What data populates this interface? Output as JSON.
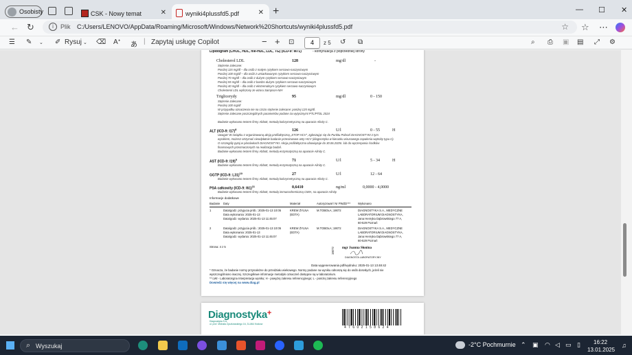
{
  "browser": {
    "profile": "Osobisty",
    "tabs": [
      {
        "title": "CSK - Nowy temat"
      },
      {
        "title": "wyniki4plussfd5.pdf"
      }
    ],
    "address_label": "Plik",
    "url": "C:/Users/LENOVO/AppData/Roaming/Microsoft/Windows/Network%20Shortcuts/wyniki4plussfd5.pdf"
  },
  "pdf_toolbar": {
    "draw": "Rysuj",
    "copilot": "Zapytaj usługę Copilot",
    "page_current": "4",
    "page_total": "z 5"
  },
  "report": {
    "header": "Lipidogram (CHOL, HDL, nie-HDL, LDL, TG) (ICD-9: M71)",
    "header_cont": "- kontynuacja z poprzedniej strony",
    "ldl_name": "Cholesterol LDL",
    "ldl_value": "128",
    "ldl_unit": "mg/dl",
    "ldl_range": "-",
    "ldl_notes": [
      "Stężenie zalecane:",
      "Poniżej 115 mg/dl – dla osób z małym ryzykiem sercowo-naczyniowym",
      "Poniżej 100 mg/dl – dla osób z umiarkowanym ryzykiem sercowo-naczyniowym",
      "Poniżej 70 mg/dl – dla osób z dużym ryzykiem sercowo-naczyniowym",
      "Poniżej 55 mg/dl – dla osób z bardzo dużym ryzykiem sercowo-naczyniowym",
      "Poniżej 40 mg/dl – dla osób z ekstremalnym ryzykiem sercowo-naczyniowym",
      "Cholesterol LDL wyliczony ze wzoru Sampson-NIH"
    ],
    "tg_name": "Triglicerydy",
    "tg_value": "95",
    "tg_unit": "mg/dl",
    "tg_range": "0 - 150",
    "tg_notes": [
      "Stężenie zalecane:",
      "Poniżej 100 mg/dl",
      "W przypadku oznaczenia nie na czczo stężenie zalecane: poniżej 125 mg/dl.",
      "Stężenie zalecane poszczególnych parametrów podane za wytycznymi PTL/PTDL 2024"
    ],
    "tg_method": "Badanie wykonano testem firmy Abbott, metodą kolorymetryczną na aparacie Alinity C.",
    "alt_name": "ALT (ICD-9: I17)",
    "alt_sup": "8",
    "alt_value": "126",
    "alt_unit": "U/l",
    "alt_range": "0 - 55",
    "alt_flag": "H",
    "alt_notes": [
      "Uwaga!! W związku z organizowaną akcją profilaktyczną „STOP HCV”, zgłaszając się do Punktu Pobrań DIAGNOSTYKI z tym",
      "wynikiem, możesz otrzymać nieodpłatnie badanie przesiewowe anty-HCV (diagnostyka w kierunku wirusowego zapalenia wątroby typu C).",
      "O szczegóły pytaj w placówkach DIAGNOSTYKI. Akcja profilaktyczna obowiązuje do 30.06.2025r. lub do wyczerpania środków",
      "finansowych przeznaczonych na realizację badań.",
      "Badanie wykonano testem firmy Abbott, metodą enzymatyczną na aparacie Alinity C."
    ],
    "ast_name": "AST (ICD-9: I19)",
    "ast_sup": "9",
    "ast_value": "71",
    "ast_unit": "U/l",
    "ast_range": "5 - 34",
    "ast_flag": "H",
    "ast_method": "Badanie wykonano testem firmy Abbott, metodą enzymatyczną na aparacie Alinity C.",
    "ggtp_name": "GGTP (ICD-9: L31)",
    "ggtp_sup": "10",
    "ggtp_value": "27",
    "ggtp_unit": "U/l",
    "ggtp_range": "12 - 64",
    "ggtp_method": "Badanie wykonano testem firmy Abbott, metodą kolorymetryczną na aparacie Alinity C.",
    "psa_name": "PSA całkowity (ICD-9: I61)",
    "psa_sup": "11",
    "psa_value": "0,6410",
    "psa_unit": "ng/ml",
    "psa_range": "0,0000 - 4,0000",
    "psa_method": "Badanie wykonano testem firmy Abbott, metodą immunochemiczną CMIA, na aparacie Alinity.",
    "info_title": "Informacje dodatkowe",
    "table_headers": [
      "Badanie",
      "Daty",
      "Materiał",
      "Autoryzował / Nr PWZD***",
      "Wykonano"
    ],
    "rows": [
      {
        "no": "1",
        "dates": [
          "Data/godz. przyjęcia prób.: 2025-01-13 10:05",
          "Data wykonania: 2025-01-13",
          "Data/godz. wydania: 2025-01-13 11:45:07"
        ],
        "material": [
          "KREW ŻYLNA",
          "(EDTA)"
        ],
        "auth": "M.TOBOŁA; 19072",
        "lab": [
          "DIAGNOSTYKA S.A., MEDYCZNE",
          "LABORATORIUM DIAGNOSTYKA,",
          "Jana Henryka Dąbrowskiego 77 A,",
          "60-529 Poznań"
        ]
      },
      {
        "no": "2",
        "dates": [
          "Data/godz. przyjęcia prób.: 2025-01-13 10:05",
          "Data wykonania: 2025-01-13",
          "Data/godz. wydania: 2025-01-13 11:45:07"
        ],
        "material": [
          "KREW ŻYLNA",
          "(EDTA)"
        ],
        "auth": "M.TOBOŁA; 19072",
        "lab": [
          "DIAGNOSTYKA S.A., MEDYCZNE",
          "LABORATORIUM DIAGNOSTYKA,",
          "Jana Henryka Dąbrowskiego 77 A,",
          "60-529 Poznań"
        ]
      }
    ],
    "page_label": "Strona: 4 z 5",
    "stamp_no": "19072",
    "signer": "mgr Joanna Słonina",
    "signer_sub": "DIAGNOSTA LABORATORYJNY",
    "generated": "Data wygenerowania pdf/wydruku: 2025-01-13 13:48:42",
    "footnotes": [
      "* Oznacza, że badanie normy przynależne do przedziału wiekowego. Normy podane na wyniku odnoszą się do osób dorosłych, jeżeli nie",
      "wyszczególniono inaczej. Szczegółowe informacje metodyki oznaczeń dostępne są w laboratorium.",
      "** LWI - Laboratoryjna Interpretacja wyniku; H - powyżej zakresu referencyjnego; L - poniżej zakresu referencyjnego"
    ],
    "more_info": "Dowiedz się więcej na www.diag.pl"
  },
  "page5": {
    "brand": "Diagnostyka",
    "brand_plus": "+",
    "brand_sub1": "Diagnostyka S.A.",
    "brand_sub2": "ul. prof. Michała Życzkowskiego 16, 31-864 Kraków",
    "barcode_digits": "4 7 6 0 2 1 5 8 6 2 4"
  },
  "taskbar": {
    "search": "Wyszukaj",
    "weather": "-2°C  Pochmurnie",
    "time": "16:22",
    "date": "13.01.2025"
  },
  "colors": {
    "brand_green": "#1a8a7a",
    "brand_red": "#d9262b",
    "pdf_red": "#c5221f"
  }
}
